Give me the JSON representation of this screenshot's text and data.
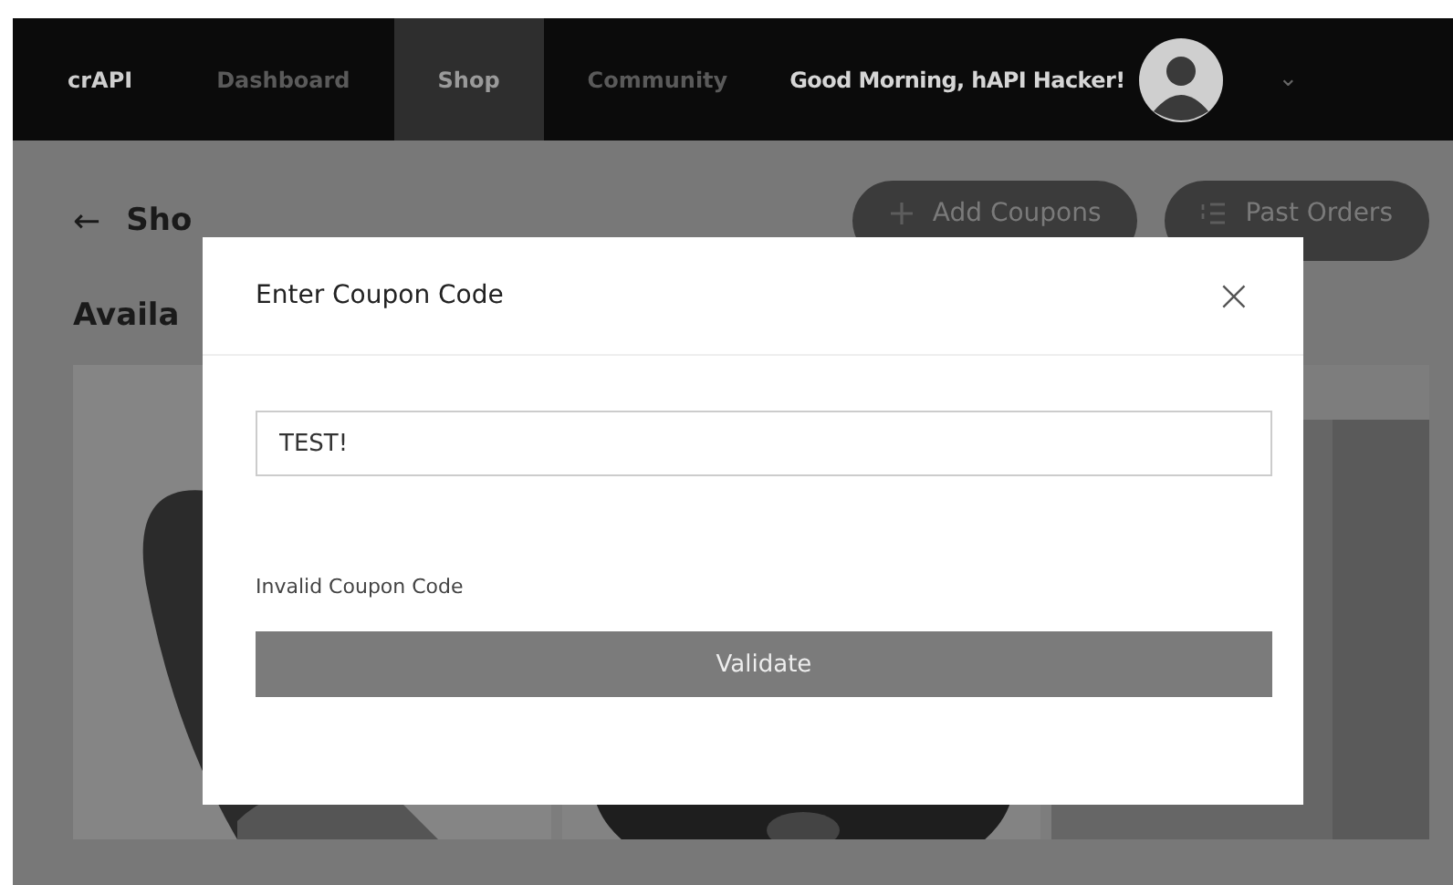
{
  "nav": {
    "brand": "crAPI",
    "items": [
      {
        "label": "Dashboard",
        "selected": false
      },
      {
        "label": "Shop",
        "selected": true
      },
      {
        "label": "Community",
        "selected": false
      }
    ],
    "greeting": "Good Morning, hAPI Hacker!",
    "menu_caret": "⌄"
  },
  "page": {
    "back": "←",
    "title": "Sho",
    "section_title": "Availa",
    "actions": [
      {
        "kind": "add",
        "label": "Add Coupons"
      },
      {
        "kind": "list",
        "label": "Past Orders"
      }
    ]
  },
  "modal": {
    "title": "Enter Coupon Code",
    "close": "×",
    "field": {
      "value": "TEST!"
    },
    "message": "Invalid Coupon Code",
    "button": "Validate"
  }
}
